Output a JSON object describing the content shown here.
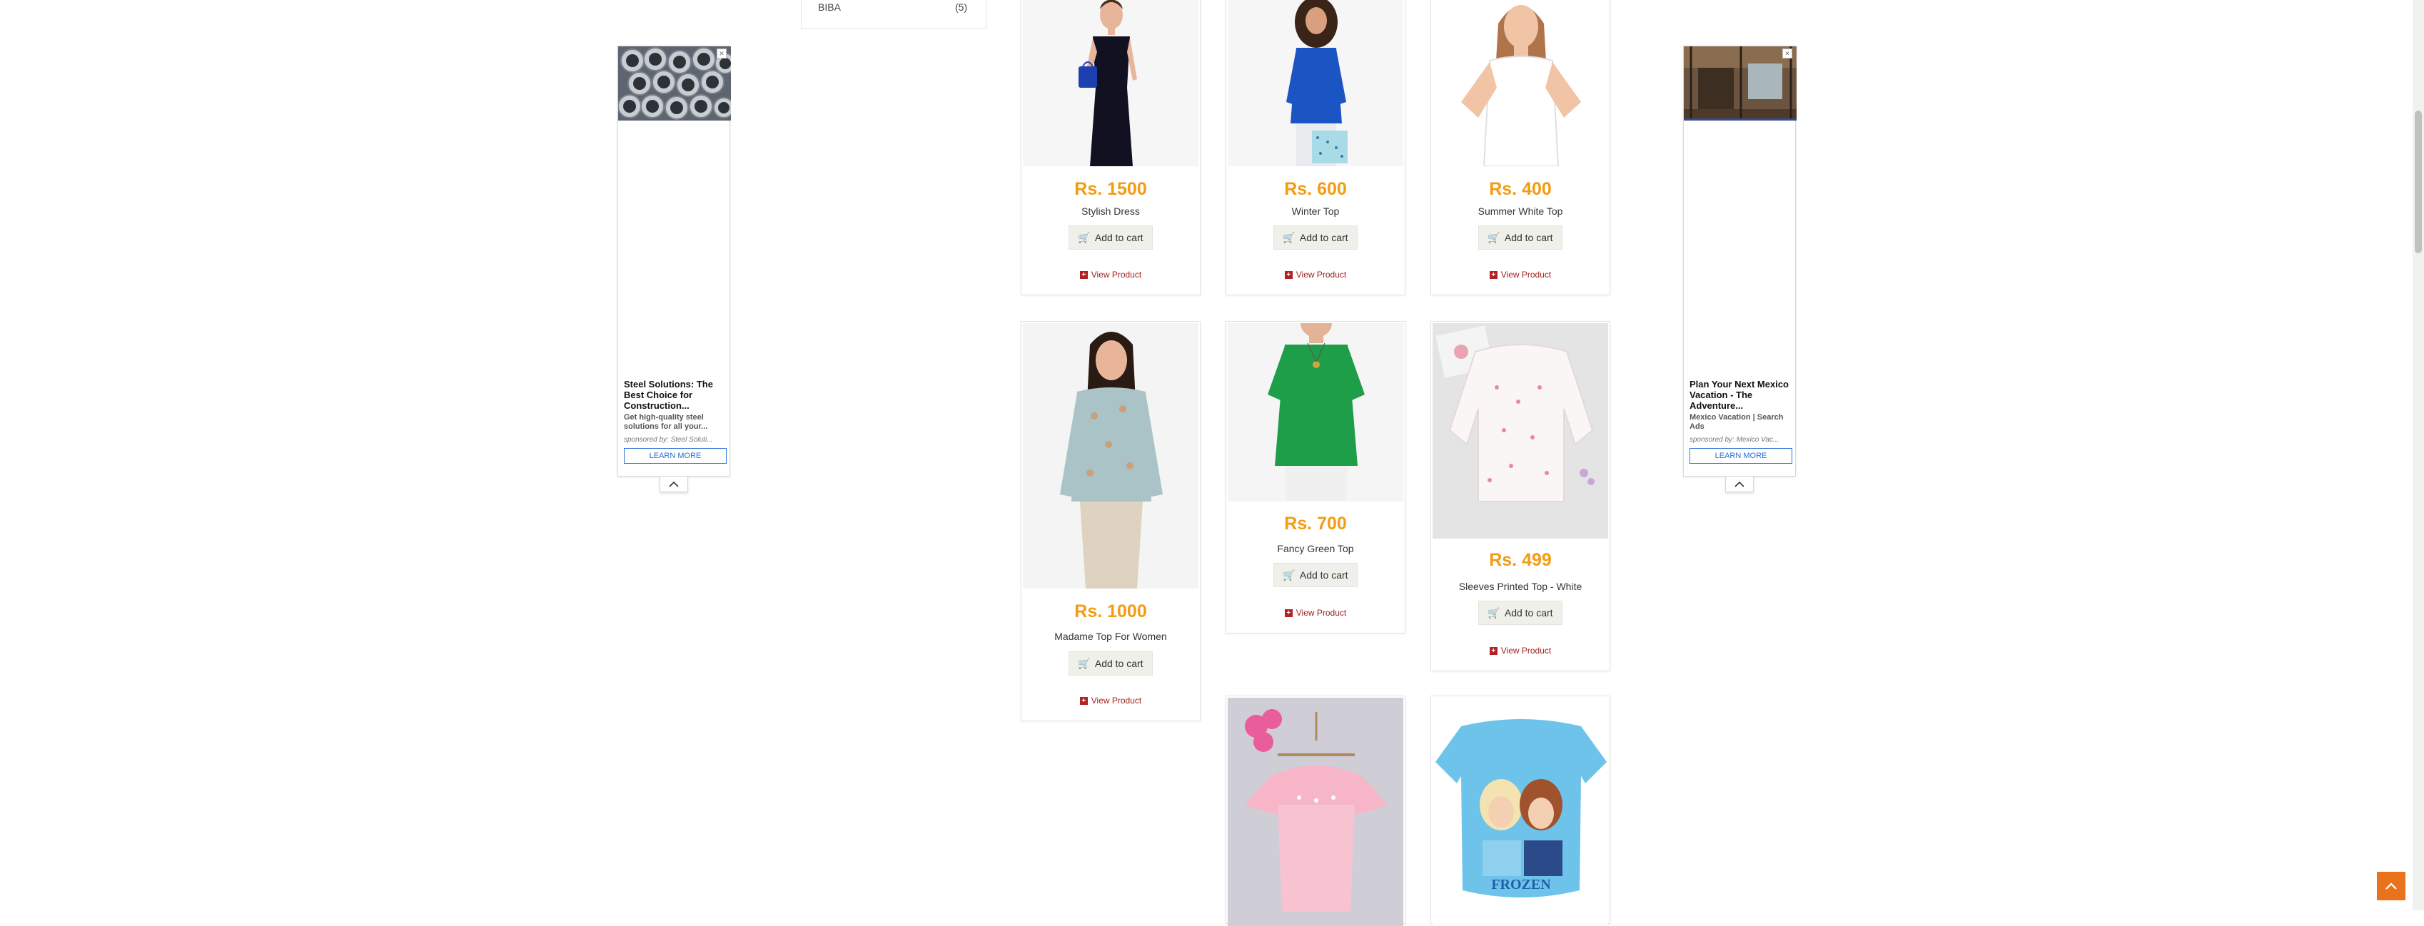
{
  "brand_filter": {
    "name": "BIBA",
    "count": "(5)"
  },
  "products": [
    {
      "price": "Rs. 1500",
      "name": "Stylish Dress",
      "cart_label": "Add to cart",
      "view_label": "View Product"
    },
    {
      "price": "Rs. 600",
      "name": "Winter Top",
      "cart_label": "Add to cart",
      "view_label": "View Product"
    },
    {
      "price": "Rs. 400",
      "name": "Summer White Top",
      "cart_label": "Add to cart",
      "view_label": "View Product"
    },
    {
      "price": "Rs. 1000",
      "name": "Madame Top For Women",
      "cart_label": "Add to cart",
      "view_label": "View Product"
    },
    {
      "price": "Rs. 700",
      "name": "Fancy Green Top",
      "cart_label": "Add to cart",
      "view_label": "View Product"
    },
    {
      "price": "Rs. 499",
      "name": "Sleeves Printed Top - White",
      "cart_label": "Add to cart",
      "view_label": "View Product"
    },
    {
      "image": "pink-ruffle-top"
    },
    {
      "image": "frozen-tshirt",
      "print": "FROZEN"
    }
  ],
  "ads": [
    {
      "title": "Steel Solutions: The Best Choice for Construction...",
      "description": "Get high-quality steel solutions for all your...",
      "sponsor": "sponsored by: Steel Soluti...",
      "cta": "LEARN MORE"
    },
    {
      "title": "Plan Your Next Mexico Vacation - The Adventure...",
      "description": "Mexico Vacation | Search Ads",
      "sponsor": "sponsored by: Mexico Vac...",
      "cta": "LEARN MORE"
    }
  ],
  "colors": {
    "price": "#f39c12",
    "view_link": "#a32020",
    "accent": "#e8731c",
    "ad_cta": "#2a6fd6"
  },
  "icons": {
    "cart": "cart-icon",
    "view": "plus-square-icon",
    "ad_collapse": "chevron-up-icon",
    "to_top": "chevron-up-icon"
  }
}
